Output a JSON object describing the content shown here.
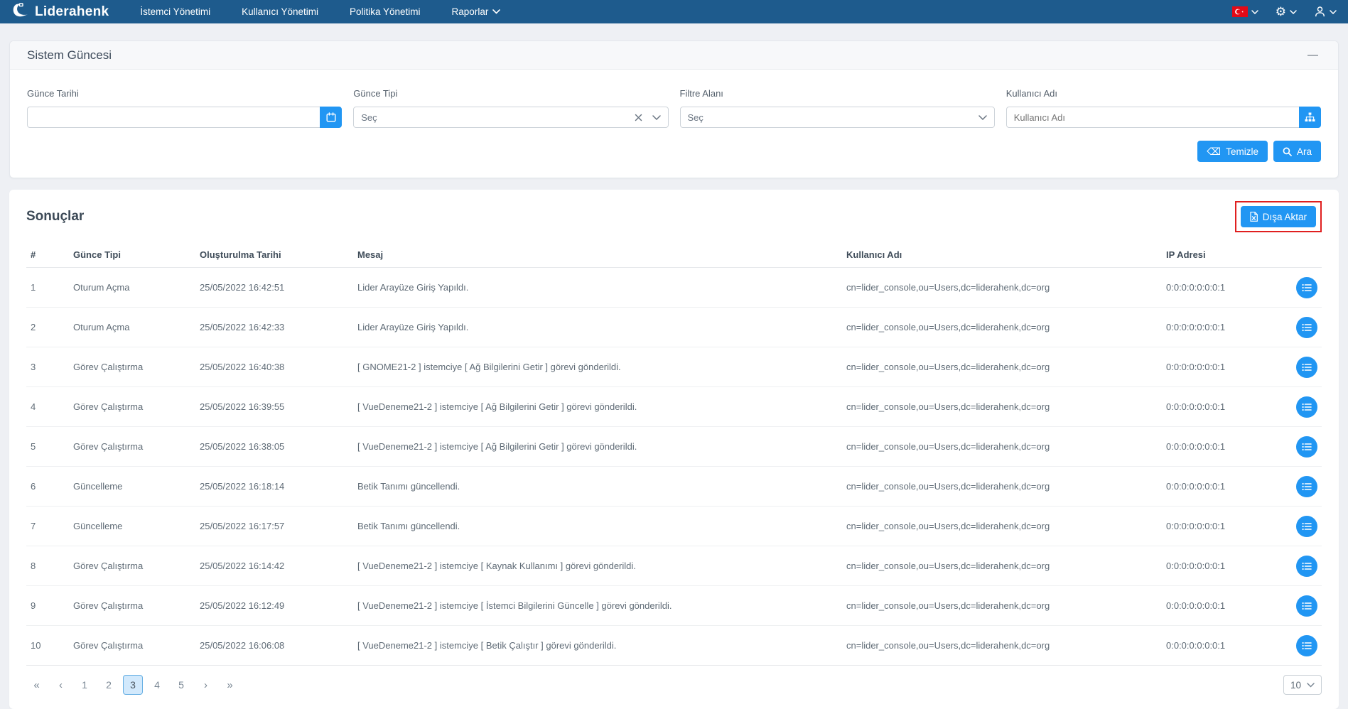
{
  "navbar": {
    "brand": "Liderahenk",
    "items": [
      {
        "label": "İstemci Yönetimi"
      },
      {
        "label": "Kullanıcı Yönetimi"
      },
      {
        "label": "Politika Yönetimi"
      },
      {
        "label": "Raporlar"
      }
    ],
    "right_icons": [
      "turkish-flag",
      "gear",
      "user"
    ]
  },
  "filter_panel": {
    "title": "Sistem Güncesi",
    "fields": {
      "date_label": "Günce Tarihi",
      "type_label": "Günce Tipi",
      "type_value": "Seç",
      "filter_label": "Filtre Alanı",
      "filter_value": "Seç",
      "user_label": "Kullanıcı Adı",
      "user_placeholder": "Kullanıcı Adı"
    },
    "buttons": {
      "clear": "Temizle",
      "search": "Ara"
    }
  },
  "results": {
    "title": "Sonuçlar",
    "export_label": "Dışa Aktar",
    "table": {
      "headers": [
        "#",
        "Günce Tipi",
        "Oluşturulma Tarihi",
        "Mesaj",
        "Kullanıcı Adı",
        "IP Adresi"
      ],
      "rows": [
        {
          "num": "1",
          "type": "Oturum Açma",
          "date": "25/05/2022 16:42:51",
          "message": "Lider Arayüze Giriş Yapıldı.",
          "user": "cn=lider_console,ou=Users,dc=liderahenk,dc=org",
          "ip": "0:0:0:0:0:0:0:1"
        },
        {
          "num": "2",
          "type": "Oturum Açma",
          "date": "25/05/2022 16:42:33",
          "message": "Lider Arayüze Giriş Yapıldı.",
          "user": "cn=lider_console,ou=Users,dc=liderahenk,dc=org",
          "ip": "0:0:0:0:0:0:0:1"
        },
        {
          "num": "3",
          "type": "Görev Çalıştırma",
          "date": "25/05/2022 16:40:38",
          "message": "[ GNOME21-2 ] istemciye [ Ağ Bilgilerini Getir ] görevi gönderildi.",
          "user": "cn=lider_console,ou=Users,dc=liderahenk,dc=org",
          "ip": "0:0:0:0:0:0:0:1"
        },
        {
          "num": "4",
          "type": "Görev Çalıştırma",
          "date": "25/05/2022 16:39:55",
          "message": "[ VueDeneme21-2 ] istemciye [ Ağ Bilgilerini Getir ] görevi gönderildi.",
          "user": "cn=lider_console,ou=Users,dc=liderahenk,dc=org",
          "ip": "0:0:0:0:0:0:0:1"
        },
        {
          "num": "5",
          "type": "Görev Çalıştırma",
          "date": "25/05/2022 16:38:05",
          "message": "[ VueDeneme21-2 ] istemciye [ Ağ Bilgilerini Getir ] görevi gönderildi.",
          "user": "cn=lider_console,ou=Users,dc=liderahenk,dc=org",
          "ip": "0:0:0:0:0:0:0:1"
        },
        {
          "num": "6",
          "type": "Güncelleme",
          "date": "25/05/2022 16:18:14",
          "message": "Betik Tanımı güncellendi.",
          "user": "cn=lider_console,ou=Users,dc=liderahenk,dc=org",
          "ip": "0:0:0:0:0:0:0:1"
        },
        {
          "num": "7",
          "type": "Güncelleme",
          "date": "25/05/2022 16:17:57",
          "message": "Betik Tanımı güncellendi.",
          "user": "cn=lider_console,ou=Users,dc=liderahenk,dc=org",
          "ip": "0:0:0:0:0:0:0:1"
        },
        {
          "num": "8",
          "type": "Görev Çalıştırma",
          "date": "25/05/2022 16:14:42",
          "message": "[ VueDeneme21-2 ] istemciye [ Kaynak Kullanımı ] görevi gönderildi.",
          "user": "cn=lider_console,ou=Users,dc=liderahenk,dc=org",
          "ip": "0:0:0:0:0:0:0:1"
        },
        {
          "num": "9",
          "type": "Görev Çalıştırma",
          "date": "25/05/2022 16:12:49",
          "message": "[ VueDeneme21-2 ] istemciye [ İstemci Bilgilerini Güncelle ] görevi gönderildi.",
          "user": "cn=lider_console,ou=Users,dc=liderahenk,dc=org",
          "ip": "0:0:0:0:0:0:0:1"
        },
        {
          "num": "10",
          "type": "Görev Çalıştırma",
          "date": "25/05/2022 16:06:08",
          "message": "[ VueDeneme21-2 ] istemciye [ Betik Çalıştır ] görevi gönderildi.",
          "user": "cn=lider_console,ou=Users,dc=liderahenk,dc=org",
          "ip": "0:0:0:0:0:0:0:1"
        }
      ]
    },
    "pagination": {
      "first": "«",
      "prev": "‹",
      "pages": [
        "1",
        "2",
        "3",
        "4",
        "5"
      ],
      "active_page": "3",
      "next": "›",
      "last": "»",
      "page_size": "10"
    }
  },
  "colors": {
    "navbar_bg": "#1e5b8d",
    "primary": "#2196f3",
    "page_bg": "#eef0f4",
    "annotation_red": "#e01f1f",
    "active_page_bg": "#d2e9fc",
    "active_page_border": "#66afe3"
  }
}
